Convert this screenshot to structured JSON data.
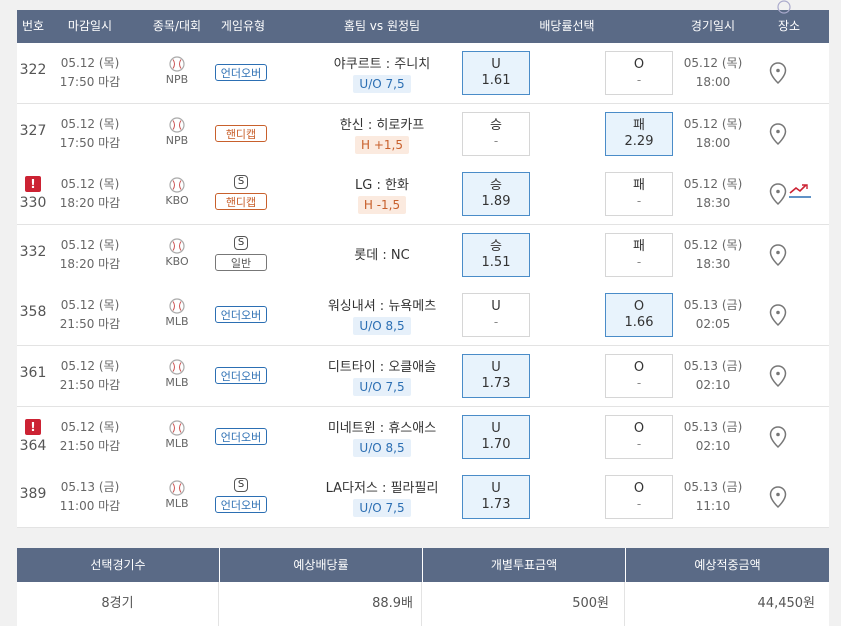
{
  "header": {
    "num": "번호",
    "deadline": "마감일시",
    "sport": "종목/대회",
    "gametype": "게임유형",
    "match": "홈팀 vs 원정팀",
    "odds": "배당률선택",
    "gametime": "경기일시",
    "venue": "장소"
  },
  "rows": [
    {
      "num": "322",
      "alert": false,
      "date": "05.12 (목)",
      "time": "17:50 마감",
      "league": "NPB",
      "special": false,
      "type": "언더오버",
      "type_kind": "ou",
      "home": "야쿠르트",
      "away": "주니치",
      "detail": "U/O 7,5",
      "left_label": "U",
      "left_val": "1.61",
      "left_sel": true,
      "right_label": "O",
      "right_val": "-",
      "right_sel": false,
      "gdate": "05.12 (목)",
      "gtime": "18:00",
      "trend": false
    },
    {
      "num": "327",
      "alert": false,
      "date": "05.12 (목)",
      "time": "17:50 마감",
      "league": "NPB",
      "special": false,
      "type": "핸디캡",
      "type_kind": "hd",
      "home": "한신",
      "away": "히로카프",
      "detail": "H +1,5",
      "left_label": "승",
      "left_val": "-",
      "left_sel": false,
      "right_label": "패",
      "right_val": "2.29",
      "right_sel": true,
      "gdate": "05.12 (목)",
      "gtime": "18:00",
      "trend": false
    },
    {
      "num": "330",
      "alert": true,
      "date": "05.12 (목)",
      "time": "18:20 마감",
      "league": "KBO",
      "special": true,
      "type": "핸디캡",
      "type_kind": "hd",
      "home": "LG",
      "away": "한화",
      "detail": "H -1,5",
      "left_label": "승",
      "left_val": "1.89",
      "left_sel": true,
      "right_label": "패",
      "right_val": "-",
      "right_sel": false,
      "gdate": "05.12 (목)",
      "gtime": "18:30",
      "trend": true
    },
    {
      "num": "332",
      "alert": false,
      "date": "05.12 (목)",
      "time": "18:20 마감",
      "league": "KBO",
      "special": true,
      "type": "일반",
      "type_kind": "ge",
      "home": "롯데",
      "away": "NC",
      "detail": "",
      "left_label": "승",
      "left_val": "1.51",
      "left_sel": true,
      "right_label": "패",
      "right_val": "-",
      "right_sel": false,
      "gdate": "05.12 (목)",
      "gtime": "18:30",
      "trend": false
    },
    {
      "num": "358",
      "alert": false,
      "date": "05.12 (목)",
      "time": "21:50 마감",
      "league": "MLB",
      "special": false,
      "type": "언더오버",
      "type_kind": "ou",
      "home": "워싱내셔",
      "away": "뉴욕메츠",
      "detail": "U/O 8,5",
      "left_label": "U",
      "left_val": "-",
      "left_sel": false,
      "right_label": "O",
      "right_val": "1.66",
      "right_sel": true,
      "gdate": "05.13 (금)",
      "gtime": "02:05",
      "trend": false
    },
    {
      "num": "361",
      "alert": false,
      "date": "05.12 (목)",
      "time": "21:50 마감",
      "league": "MLB",
      "special": false,
      "type": "언더오버",
      "type_kind": "ou",
      "home": "디트타이",
      "away": "오클애슬",
      "detail": "U/O 7,5",
      "left_label": "U",
      "left_val": "1.73",
      "left_sel": true,
      "right_label": "O",
      "right_val": "-",
      "right_sel": false,
      "gdate": "05.13 (금)",
      "gtime": "02:10",
      "trend": false
    },
    {
      "num": "364",
      "alert": true,
      "date": "05.12 (목)",
      "time": "21:50 마감",
      "league": "MLB",
      "special": false,
      "type": "언더오버",
      "type_kind": "ou",
      "home": "미네트윈",
      "away": "휴스애스",
      "detail": "U/O 8,5",
      "left_label": "U",
      "left_val": "1.70",
      "left_sel": true,
      "right_label": "O",
      "right_val": "-",
      "right_sel": false,
      "gdate": "05.13 (금)",
      "gtime": "02:10",
      "trend": false
    },
    {
      "num": "389",
      "alert": false,
      "date": "05.13 (금)",
      "time": "11:00 마감",
      "league": "MLB",
      "special": true,
      "type": "언더오버",
      "type_kind": "ou",
      "home": "LA다저스",
      "away": "필라필리",
      "detail": "U/O 7,5",
      "left_label": "U",
      "left_val": "1.73",
      "left_sel": true,
      "right_label": "O",
      "right_val": "-",
      "right_sel": false,
      "gdate": "05.13 (금)",
      "gtime": "11:10",
      "trend": false
    }
  ],
  "summary": {
    "headers": [
      "선택경기수",
      "예상배당률",
      "개별투표금액",
      "예상적중금액"
    ],
    "values": [
      "8경기",
      "88.9배",
      "500원",
      "44,450원"
    ]
  },
  "colors": {
    "header_bg": "#5a6a86",
    "selected_bg": "#e8f3fc",
    "alert": "#cc2233"
  }
}
